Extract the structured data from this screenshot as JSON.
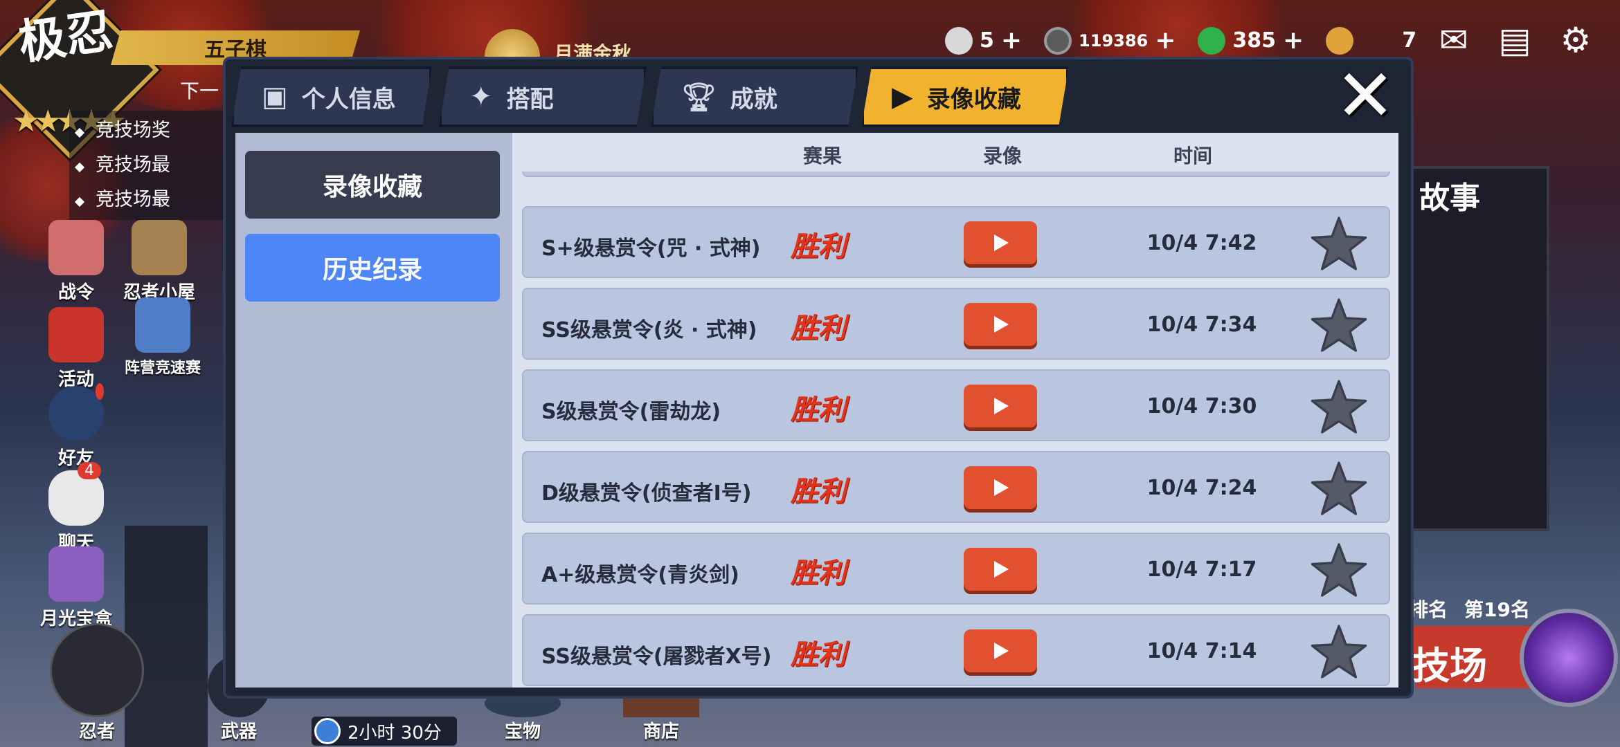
{
  "header": {
    "logo_text": "极忍",
    "mode_banner": "五子棋",
    "next_line": "下一",
    "arena_lines": [
      "竞技场奖",
      "竞技场最",
      "竞技场最"
    ],
    "event_label": "月满金秋"
  },
  "resources": [
    {
      "icon": "rice-ball-icon",
      "value": "5",
      "color": "#cfcfcf"
    },
    {
      "icon": "coin-icon",
      "value": "119386",
      "color": "#8a8a8a"
    },
    {
      "icon": "jade-icon",
      "value": "385",
      "color": "#2fb24a"
    },
    {
      "icon": "key-icon",
      "value": "7",
      "color": "#e0a23a"
    }
  ],
  "side_menu": [
    {
      "label": "战令",
      "icon": "battle-pass-icon"
    },
    {
      "label": "忍者小屋",
      "icon": "ninja-house-icon"
    },
    {
      "label": "活动",
      "icon": "torii-icon"
    },
    {
      "label": "阵营竞速赛",
      "icon": "camp-race-icon"
    },
    {
      "label": "好友",
      "icon": "friends-icon"
    },
    {
      "label": "聊天",
      "icon": "chat-icon",
      "badge": "4"
    },
    {
      "label": "月光宝盒",
      "icon": "moonlight-box-icon"
    }
  ],
  "bottom_nav": {
    "ninja": "忍者",
    "weapon": "武器",
    "treasure": "宝物",
    "shop": "商店",
    "timer": "2小时 30分"
  },
  "right_panel": {
    "story_title": "故事",
    "rank_label": "排名",
    "rank_value": "第19名",
    "arena": "技场"
  },
  "modal": {
    "tabs": [
      {
        "label": "个人信息",
        "icon": "id-card-icon"
      },
      {
        "label": "搭配",
        "icon": "shuriken-icon"
      },
      {
        "label": "成就",
        "icon": "trophy-icon"
      },
      {
        "label": "录像收藏",
        "icon": "play-icon"
      }
    ],
    "active_tab": "录像收藏",
    "sidebar": {
      "recordings": "录像收藏",
      "history": "历史纪录"
    },
    "columns": {
      "result": "赛果",
      "replay": "录像",
      "time": "时间"
    },
    "rows": [
      {
        "name": "S+级悬赏令(咒 · 式神)",
        "result": "胜利",
        "time": "10/4 7:42"
      },
      {
        "name": "SS级悬赏令(炎 · 式神)",
        "result": "胜利",
        "time": "10/4 7:34"
      },
      {
        "name": "S级悬赏令(雷劫龙)",
        "result": "胜利",
        "time": "10/4 7:30"
      },
      {
        "name": "D级悬赏令(侦查者I号)",
        "result": "胜利",
        "time": "10/4 7:24"
      },
      {
        "name": "A+级悬赏令(青炎剑)",
        "result": "胜利",
        "time": "10/4 7:17"
      },
      {
        "name": "SS级悬赏令(屠戮者X号)",
        "result": "胜利",
        "time": "10/4 7:14"
      }
    ]
  }
}
